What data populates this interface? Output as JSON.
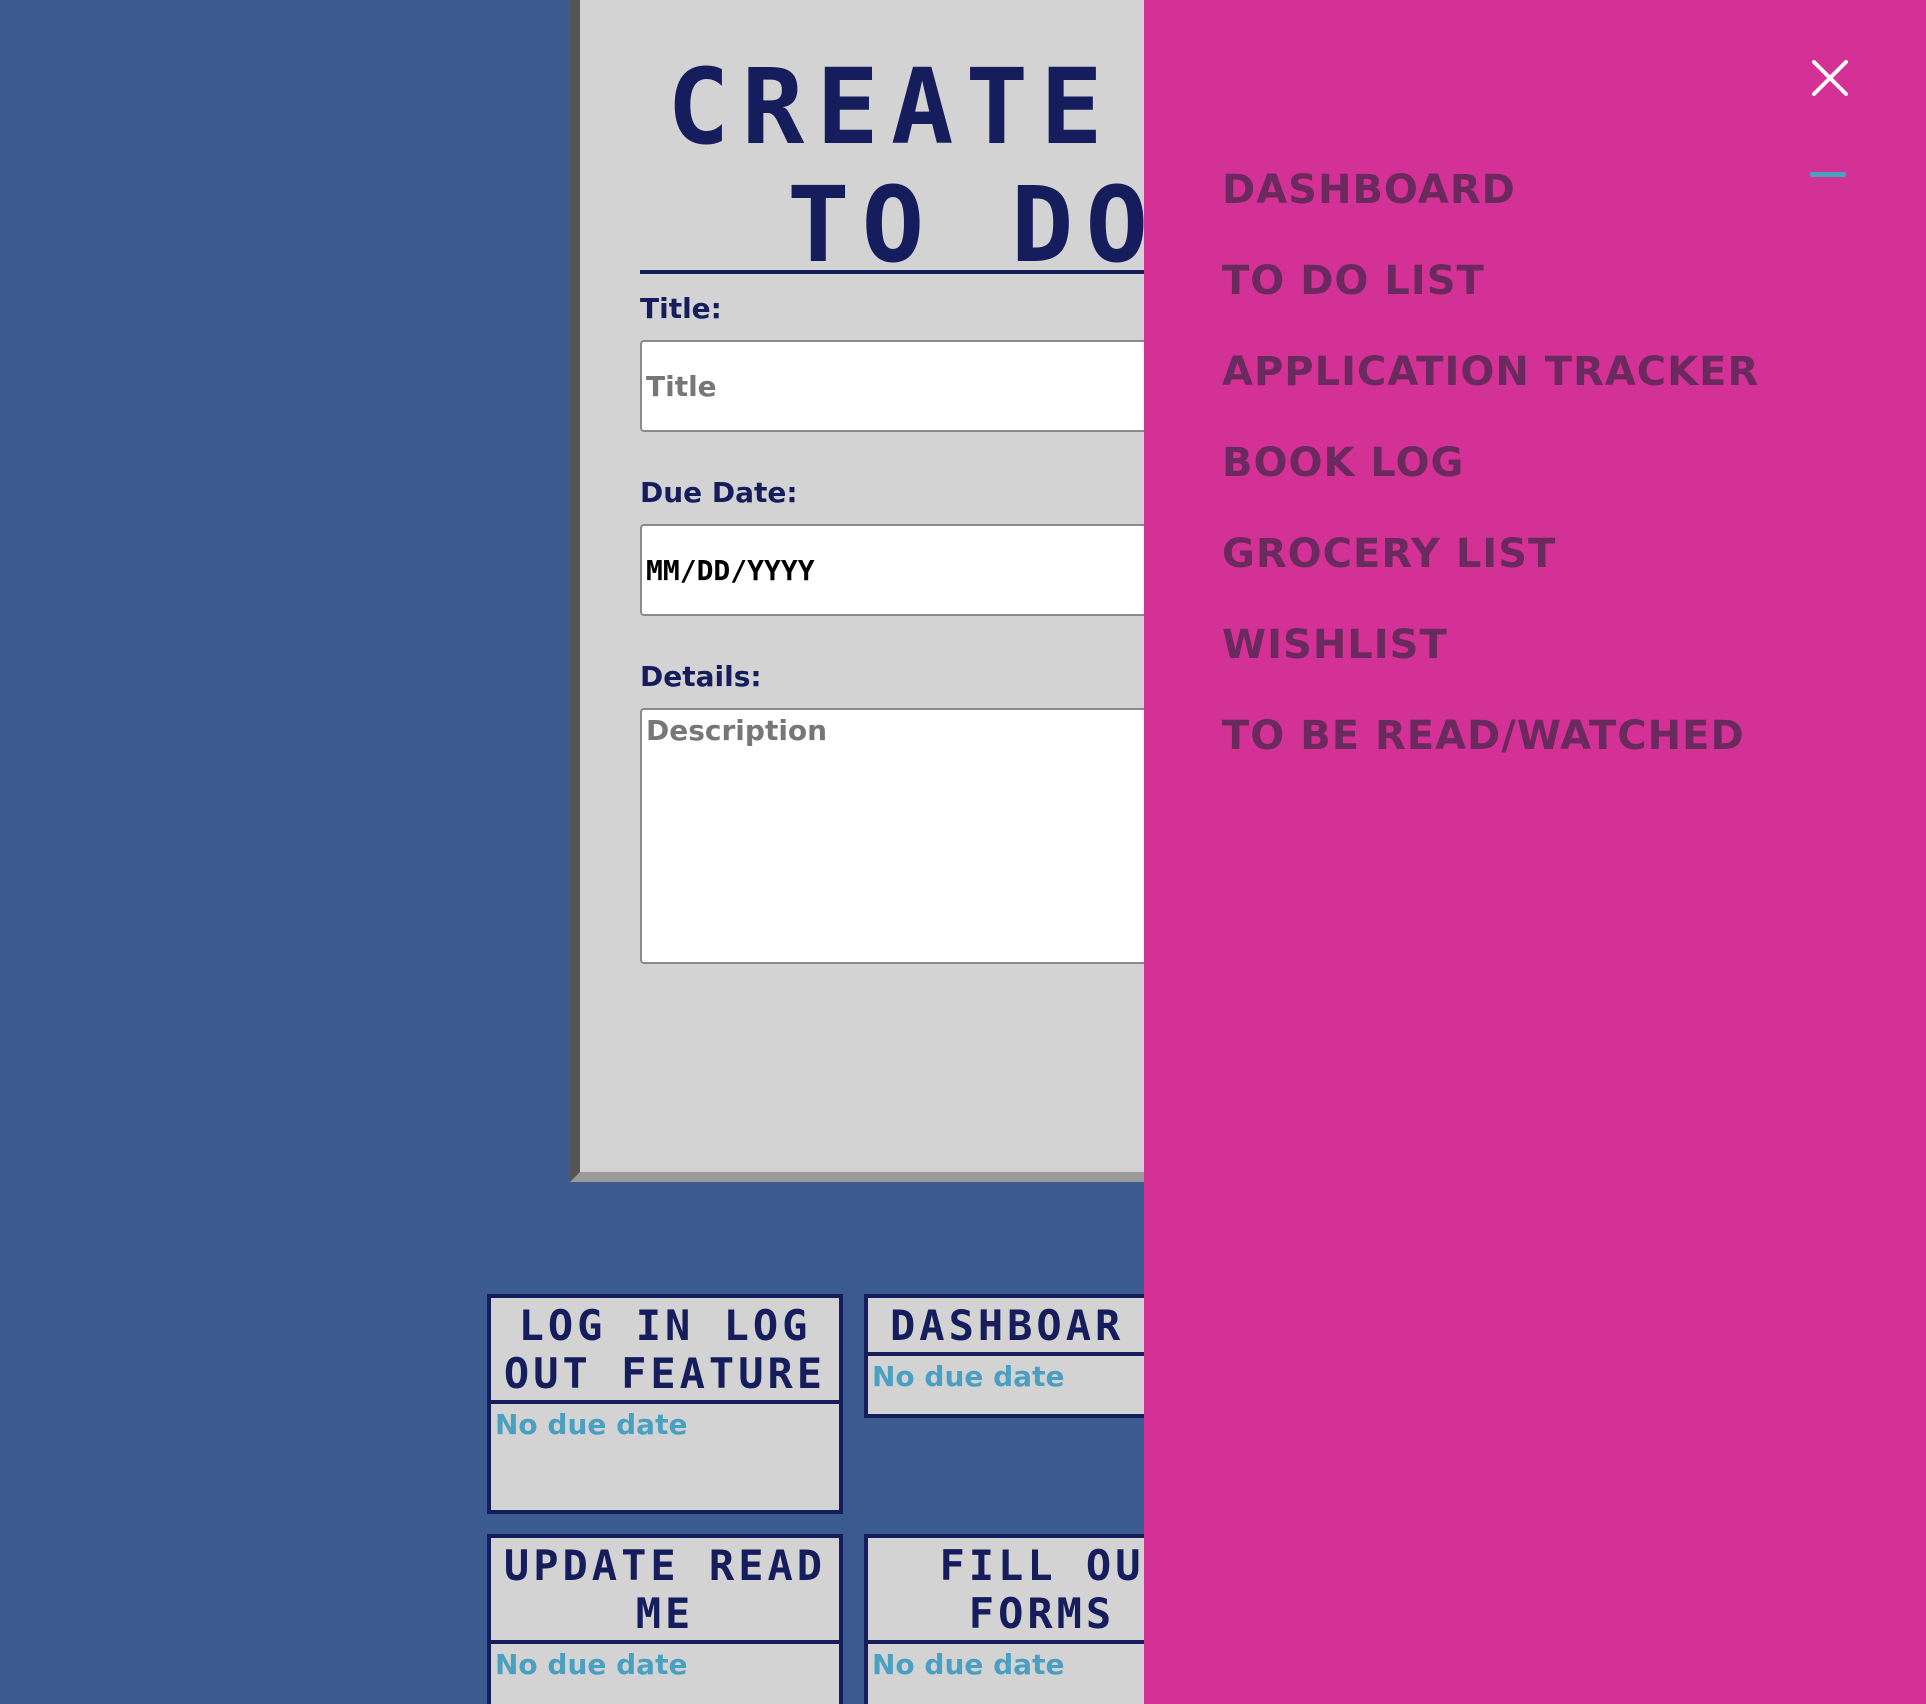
{
  "form": {
    "heading_line1": "CREATE",
    "heading_line2": "TO DO",
    "title_label": "Title:",
    "title_placeholder": "Title",
    "due_label": "Due Date:",
    "due_value": "MM/DD/YYYY",
    "details_label": "Details:",
    "details_placeholder": "Description"
  },
  "tasks": [
    {
      "title": "LOG IN LOG OUT FEATURE",
      "due": "No due date"
    },
    {
      "title": "DASHBOAR",
      "due": "No due date"
    },
    {
      "title": "UPDATE READ ME",
      "due": "No due date"
    },
    {
      "title": "FILL OU FORMS",
      "due": "No due date"
    }
  ],
  "sidenav": {
    "close_icon": "close-icon",
    "items": [
      "DASHBOARD",
      "TO DO LIST",
      "APPLICATION TRACKER",
      "BOOK LOG",
      "GROCERY LIST",
      "WISHLIST",
      "TO BE READ/WATCHED"
    ]
  },
  "colors": {
    "background": "#3b5a8f",
    "card": "#d3d3d3",
    "navy": "#151d5c",
    "sidenav": "#d43196",
    "nav_text": "#6a2a5e",
    "accent": "#4aa0c0"
  }
}
